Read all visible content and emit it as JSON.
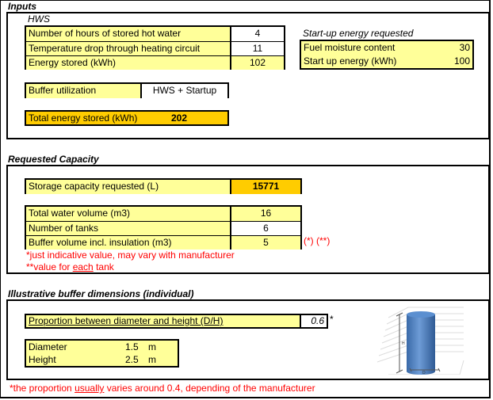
{
  "inputs": {
    "title": "Inputs",
    "hws_label": "HWS",
    "rows": [
      {
        "label": "Number of hours of stored hot water",
        "value": "4"
      },
      {
        "label": "Temperature drop through heating circuit",
        "value": "11"
      },
      {
        "label": "Energy stored (kWh)",
        "value": "102"
      }
    ],
    "startup": {
      "title": "Start-up energy requested",
      "rows": [
        {
          "label": "Fuel moisture content",
          "value": "30"
        },
        {
          "label": "Start up energy (kWh)",
          "value": "100"
        }
      ]
    },
    "buffer_utilization": {
      "label": "Buffer utilization",
      "value": "HWS + Startup"
    },
    "total_energy": {
      "label": "Total energy stored (kWh)",
      "value": "202"
    }
  },
  "capacity": {
    "title": "Requested Capacity",
    "storage": {
      "label": "Storage capacity requested (L)",
      "value": "15771"
    },
    "rows": [
      {
        "label": "Total water volume (m3)",
        "value": "16"
      },
      {
        "label": "Number of tanks",
        "value": "6"
      },
      {
        "label": "Buffer volume incl. insulation (m3)",
        "value": "5"
      }
    ],
    "footnote_marker": "(*) (**)",
    "note1": "*just indicative value, may vary with manufacturer",
    "note2_prefix": "**value for ",
    "note2_underlined": "each",
    "note2_suffix": " tank"
  },
  "dimensions": {
    "title": "Illustrative buffer dimensions (individual)",
    "proportion": {
      "label": "Proportion between diameter and height (D/H)",
      "value": "0.6",
      "marker": "*"
    },
    "diameter": {
      "label": "Diameter",
      "value": "1.5",
      "unit": "m"
    },
    "height": {
      "label": "Height",
      "value": "2.5",
      "unit": "m"
    },
    "illustration": {
      "h_label": "H",
      "d_label": "D"
    },
    "note_prefix": "*the proportion ",
    "note_underlined": "usually",
    "note_suffix": " varies around 0.4, depending of the manufacturer"
  },
  "colors": {
    "input_yellow": "#ffff99",
    "highlight_orange": "#ffcc00",
    "note_red": "#ff0000",
    "tank_blue": "#4a7ebf"
  }
}
